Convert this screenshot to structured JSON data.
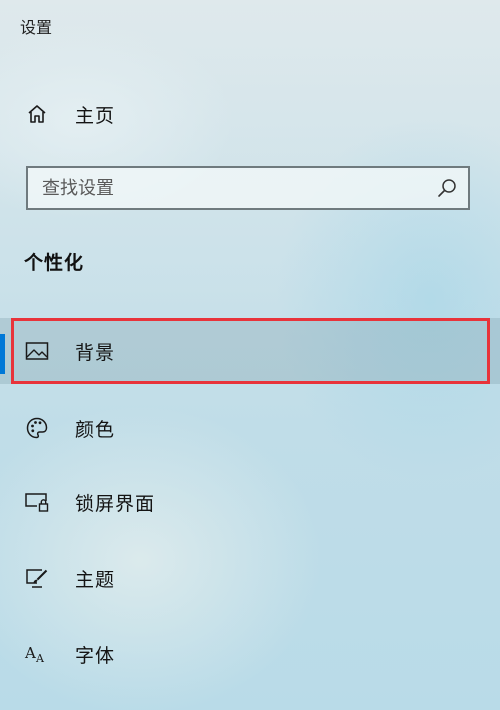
{
  "window": {
    "title": "设置"
  },
  "nav": {
    "home": {
      "label": "主页",
      "icon": "home-icon"
    }
  },
  "search": {
    "placeholder": "查找设置",
    "icon": "search-icon"
  },
  "section": {
    "heading": "个性化"
  },
  "menu": {
    "items": [
      {
        "label": "背景",
        "icon": "image-icon",
        "selected": true
      },
      {
        "label": "颜色",
        "icon": "palette-icon",
        "selected": false
      },
      {
        "label": "锁屏界面",
        "icon": "lock-screen-icon",
        "selected": false
      },
      {
        "label": "主题",
        "icon": "theme-brush-icon",
        "selected": false
      },
      {
        "label": "字体",
        "icon": "font-icon",
        "selected": false
      }
    ]
  },
  "colors": {
    "accent": "#0078d7",
    "highlight_border": "#e8333a"
  }
}
